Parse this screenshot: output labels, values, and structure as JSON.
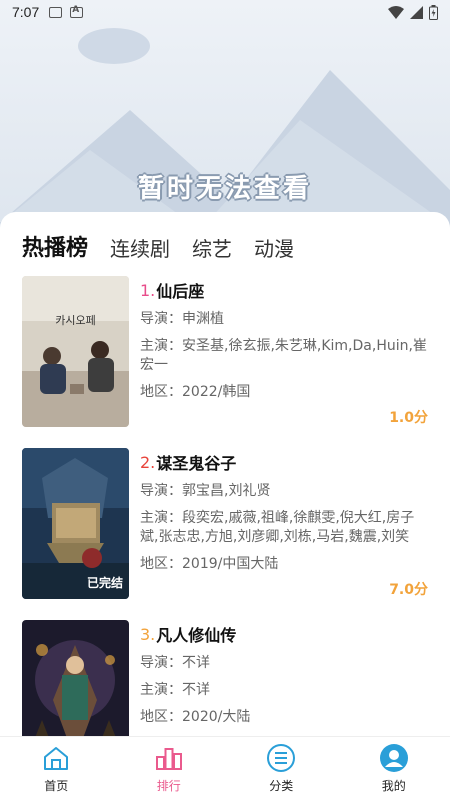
{
  "status_bar": {
    "time": "7:07"
  },
  "banner": {
    "notice": "暂时无法查看"
  },
  "tabs": [
    {
      "label": "热播榜",
      "active": true
    },
    {
      "label": "连续剧",
      "active": false
    },
    {
      "label": "综艺",
      "active": false
    },
    {
      "label": "动漫",
      "active": false
    }
  ],
  "items": [
    {
      "rank": "1.",
      "rank_color": "#e84c8a",
      "title": "仙后座",
      "director": "导演：申渊植",
      "cast": "主演：安圣基,徐玄振,朱艺琳,Kim,Da,Huin,崔宏一",
      "region": "地区：2022/韩国",
      "score": "1.0分",
      "poster_text": "카시오페"
    },
    {
      "rank": "2.",
      "rank_color": "#e8433a",
      "title": "谋圣鬼谷子",
      "director": "导演：郭宝昌,刘礼贤",
      "cast": "主演：段奕宏,戚薇,祖峰,徐麒雯,倪大红,房子斌,张志忠,方旭,刘彦卿,刘栋,马岩,魏震,刘笑",
      "region": "地区：2019/中国大陆",
      "score": "7.0分",
      "poster_text": "已完结"
    },
    {
      "rank": "3.",
      "rank_color": "#f2a33b",
      "title": "凡人修仙传",
      "director": "导演：不详",
      "cast": "主演：不详",
      "region": "地区：2020/大陆",
      "score": "",
      "poster_text": ""
    }
  ],
  "nav": [
    {
      "label": "首页",
      "icon": "home-icon",
      "color": "#2a9fd8"
    },
    {
      "label": "排行",
      "icon": "ranking-icon",
      "color": "#ea5a8d"
    },
    {
      "label": "分类",
      "icon": "category-icon",
      "color": "#2a9fd8"
    },
    {
      "label": "我的",
      "icon": "profile-icon",
      "color": "#2a9fd8"
    }
  ]
}
